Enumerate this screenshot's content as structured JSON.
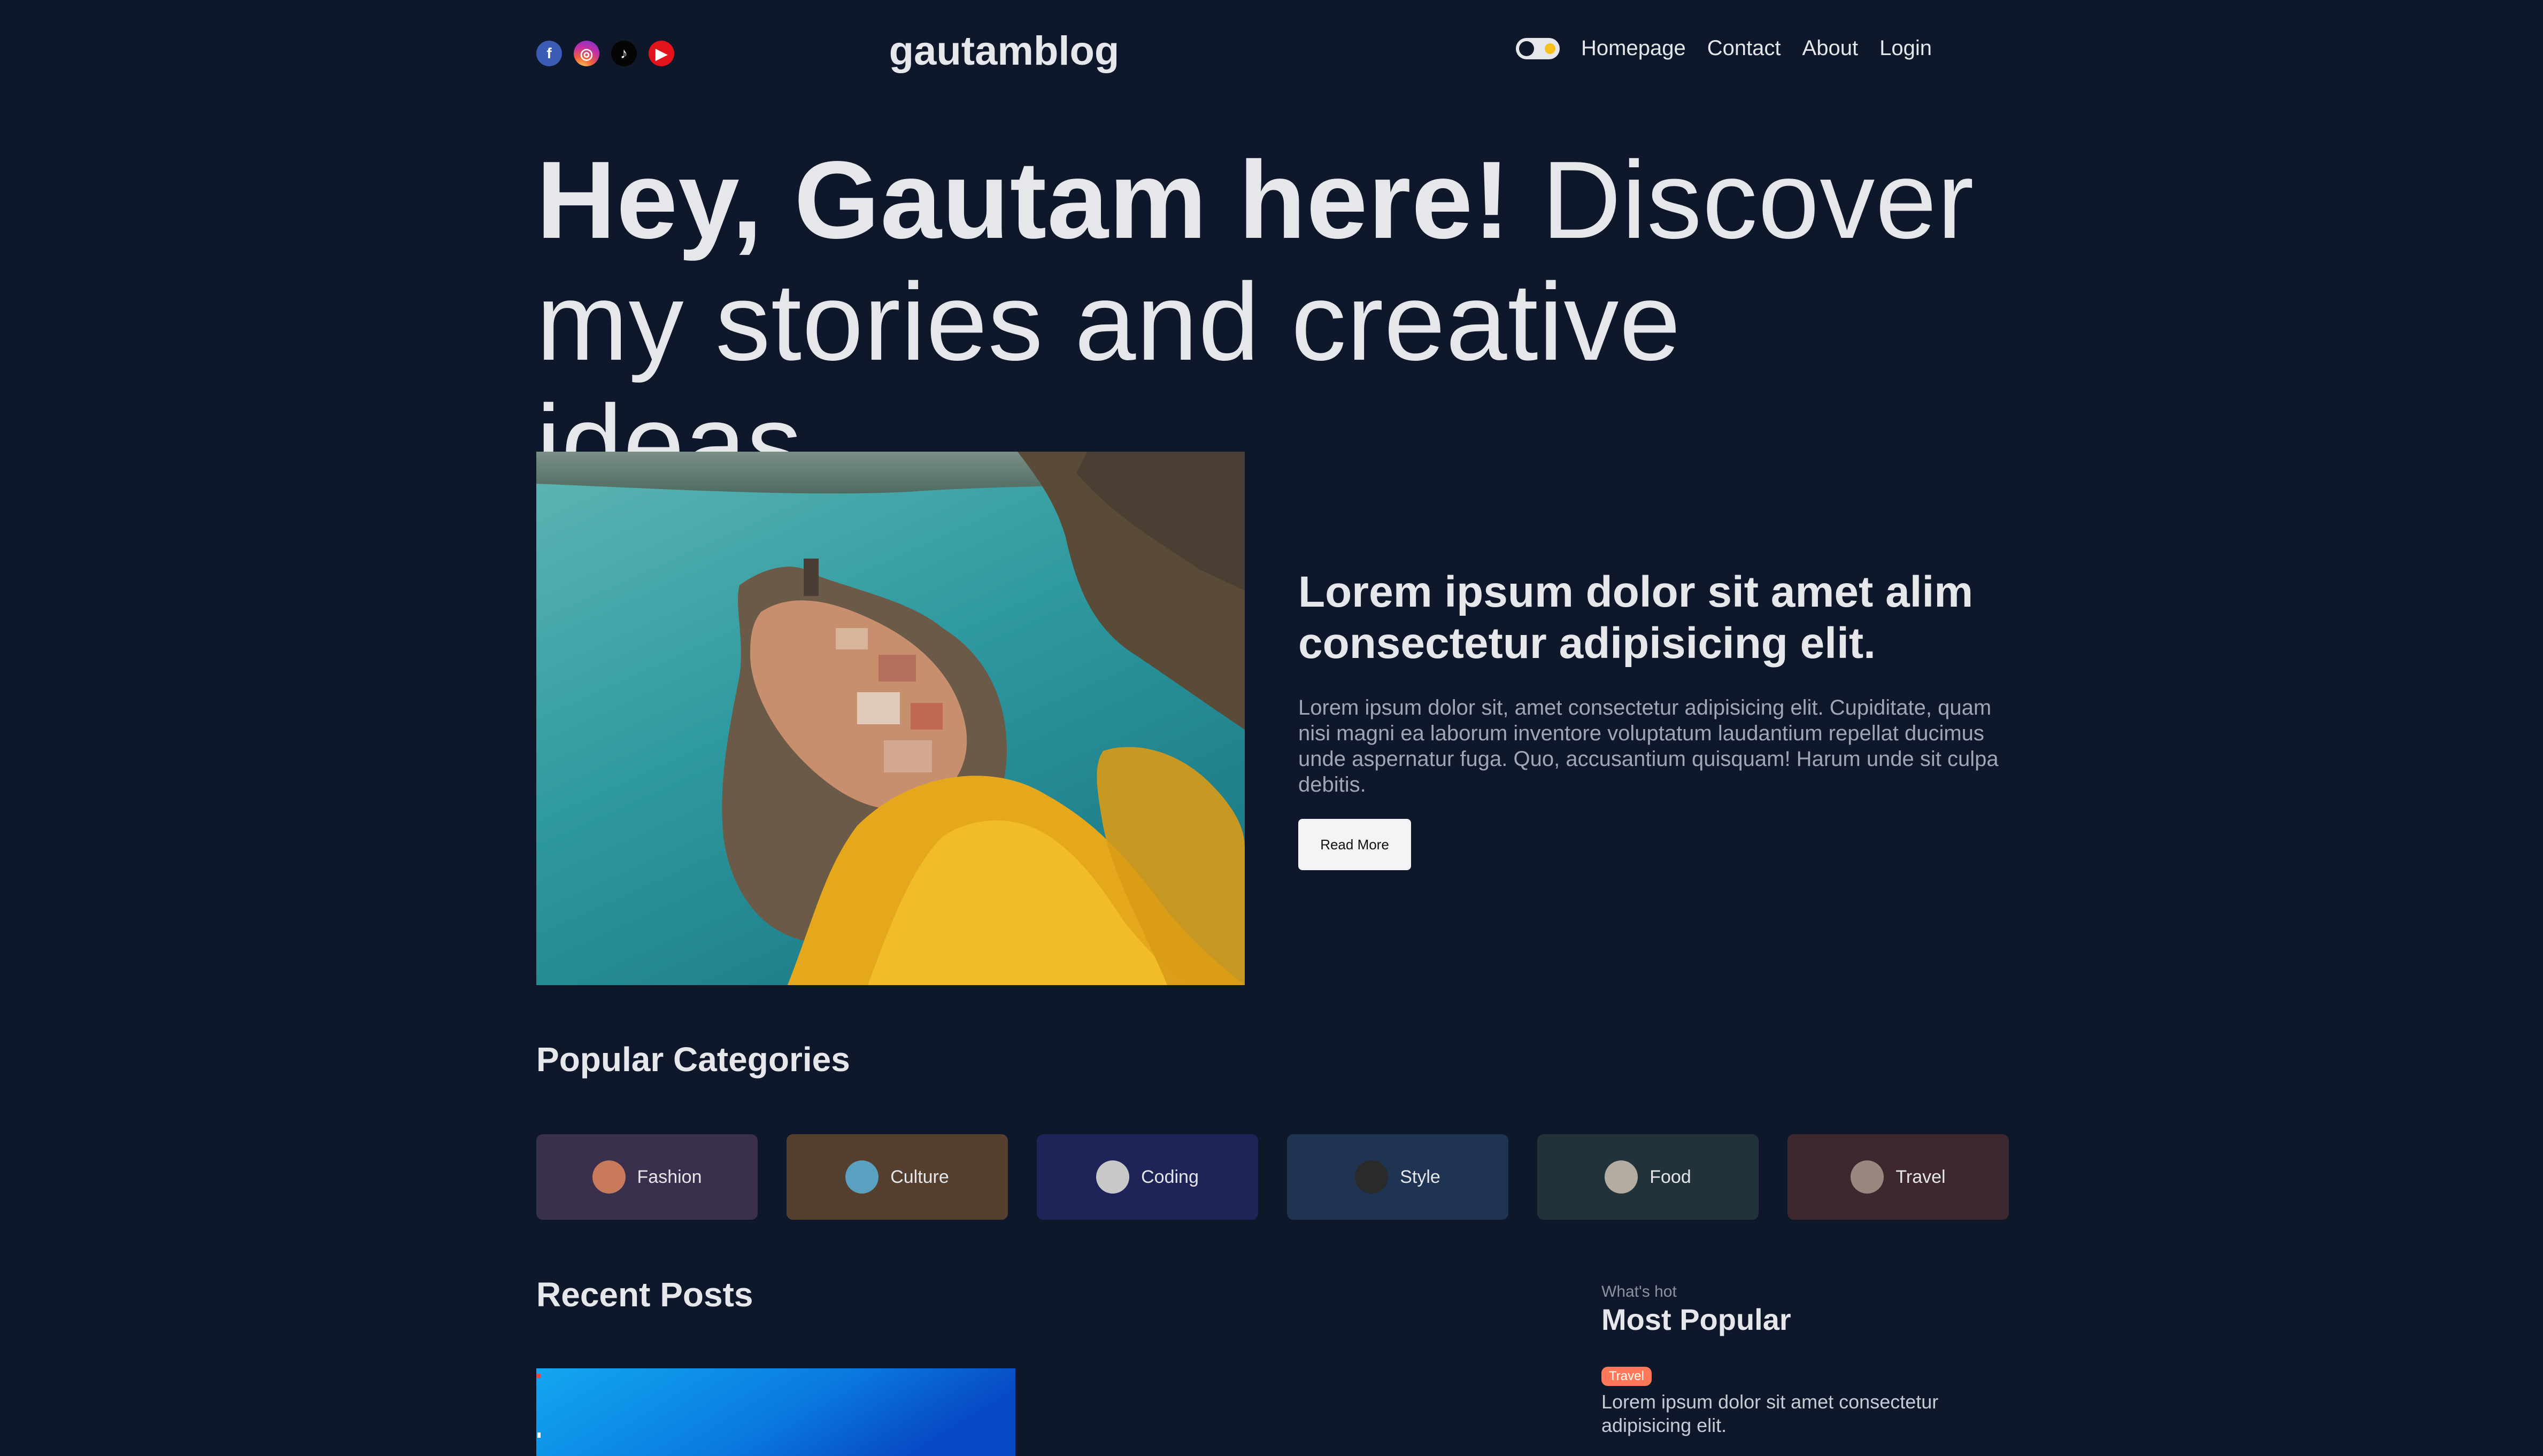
{
  "navbar": {
    "socials": [
      {
        "name": "facebook-icon",
        "glyph": "f"
      },
      {
        "name": "instagram-icon",
        "glyph": "◎"
      },
      {
        "name": "tiktok-icon",
        "glyph": "♪"
      },
      {
        "name": "youtube-icon",
        "glyph": "▶"
      }
    ],
    "logo": "gautamblog",
    "links": [
      "Homepage",
      "Contact",
      "About",
      "Login"
    ]
  },
  "hero": {
    "bold": "Hey, Gautam here!",
    "light": " Discover my stories and creative ideas."
  },
  "featured": {
    "title": "Lorem ipsum dolor sit amet alim consectetur adipisicing elit.",
    "desc": "Lorem ipsum dolor sit, amet consectetur adipisicing elit. Cupiditate, quam nisi magni ea laborum inventore voluptatum laudantium repellat ducimus unde aspernatur fuga. Quo, accusantium quisquam! Harum unde sit culpa debitis.",
    "button": "Read More"
  },
  "categories": {
    "title": "Popular Categories",
    "items": [
      {
        "label": "Fashion",
        "bg": "#3a2f4c",
        "avatar": "#c97a5a"
      },
      {
        "label": "Culture",
        "bg": "#554030",
        "avatar": "#5aa0c0"
      },
      {
        "label": "Coding",
        "bg": "#1f2458",
        "avatar": "#c8c8c8"
      },
      {
        "label": "Style",
        "bg": "#1e3452",
        "avatar": "#2a2a2a"
      },
      {
        "label": "Food",
        "bg": "#22323a",
        "avatar": "#b4aca0"
      },
      {
        "label": "Travel",
        "bg": "#3e2830",
        "avatar": "#9a8880"
      }
    ]
  },
  "recent": {
    "title": "Recent Posts"
  },
  "popular": {
    "subtitle": "What's hot",
    "title": "Most Popular",
    "tag": "Travel",
    "post": "Lorem ipsum dolor sit amet consectetur adipisicing elit."
  }
}
